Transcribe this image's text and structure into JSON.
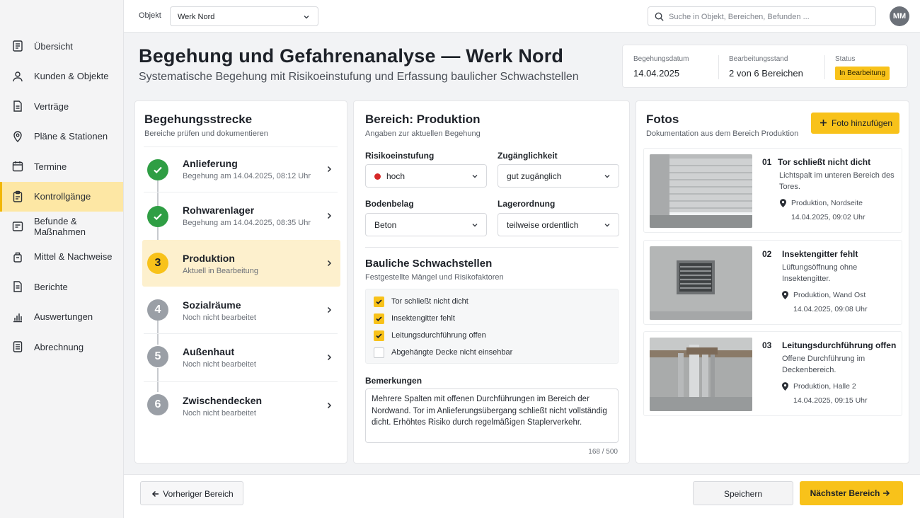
{
  "sidebar": {
    "items": [
      {
        "label": "Übersicht",
        "icon": "document-icon"
      },
      {
        "label": "Kunden & Objekte",
        "icon": "users-icon"
      },
      {
        "label": "Verträge",
        "icon": "contract-icon"
      },
      {
        "label": "Pläne & Stationen",
        "icon": "map-pin-icon"
      },
      {
        "label": "Termine",
        "icon": "calendar-icon"
      },
      {
        "label": "Kontrollgänge",
        "icon": "clipboard-icon",
        "active": true
      },
      {
        "label": "Befunde & Maßnahmen",
        "icon": "findings-icon"
      },
      {
        "label": "Mittel & Nachweise",
        "icon": "container-icon"
      },
      {
        "label": "Berichte",
        "icon": "report-icon"
      },
      {
        "label": "Auswertungen",
        "icon": "bar-chart-icon"
      },
      {
        "label": "Abrechnung",
        "icon": "invoice-icon"
      }
    ]
  },
  "topbar": {
    "object_label": "Objekt",
    "object_value": "Werk Nord",
    "search_placeholder": "Suche in Objekt, Bereichen, Befunden ...",
    "avatar": "MM"
  },
  "header": {
    "title": "Begehung und Gefahrenanalyse — Werk Nord",
    "subtitle": "Systematische Begehung mit Risikoeinstufung und Erfassung baulicher Schwachstellen",
    "meta": {
      "date_label": "Begehungsdatum",
      "date_value": "14.04.2025",
      "progress_label": "Bearbeitungsstand",
      "progress_value": "2 von 6 Bereichen",
      "status_label": "Status",
      "status_value": "In Bearbeitung"
    }
  },
  "route": {
    "title": "Begehungsstrecke",
    "subtitle": "Bereiche prüfen und dokumentieren",
    "items": [
      {
        "state": "done",
        "num": "",
        "name": "Anlieferung",
        "sub": "Begehung am 14.04.2025, 08:12 Uhr"
      },
      {
        "state": "done",
        "num": "",
        "name": "Rohwarenlager",
        "sub": "Begehung am 14.04.2025, 08:35 Uhr"
      },
      {
        "state": "current",
        "num": "3",
        "name": "Produktion",
        "sub": "Aktuell in Bearbeitung"
      },
      {
        "state": "todo",
        "num": "4",
        "name": "Sozialräume",
        "sub": "Noch nicht bearbeitet"
      },
      {
        "state": "todo",
        "num": "5",
        "name": "Außenhaut",
        "sub": "Noch nicht bearbeitet"
      },
      {
        "state": "todo",
        "num": "6",
        "name": "Zwischendecken",
        "sub": "Noch nicht bearbeitet"
      }
    ]
  },
  "area": {
    "title": "Bereich: Produktion",
    "subtitle": "Angaben zur aktuellen Begehung",
    "risk_label": "Risikoeinstufung",
    "risk_value": "hoch",
    "risk_color": "#d62828",
    "access_label": "Zugänglichkeit",
    "access_value": "gut zugänglich",
    "floor_label": "Bodenbelag",
    "floor_value": "Beton",
    "storage_label": "Lagerordnung",
    "storage_value": "teilweise ordentlich",
    "weak_title": "Bauliche Schwachstellen",
    "weak_subtitle": "Festgestellte Mängel und Risikofaktoren",
    "checks": [
      {
        "label": "Tor schließt nicht dicht",
        "checked": true
      },
      {
        "label": "Insektengitter fehlt",
        "checked": true
      },
      {
        "label": "Leitungsdurchführung offen",
        "checked": true
      },
      {
        "label": "Abgehängte Decke nicht einsehbar",
        "checked": false
      }
    ],
    "remarks_label": "Bemerkungen",
    "remarks_text": "Mehrere Spalten mit offenen Durchführungen im Bereich der Nordwand. Tor im Anlieferungsübergang schließt nicht vollständig dicht. Erhöhtes Risiko durch regelmäßigen Staplerverkehr.",
    "counter": "168 / 500"
  },
  "photos": {
    "title": "Fotos",
    "subtitle": "Dokumentation aus dem Bereich Produktion",
    "add_label": "Foto hinzufügen",
    "items": [
      {
        "num": "01",
        "title": "Tor schließt nicht dicht",
        "desc": "Lichtspalt im unteren Bereich des Tores.",
        "location": "Produktion, Nordseite",
        "time": "14.04.2025, 09:02 Uhr"
      },
      {
        "num": "02",
        "title": "Insektengitter fehlt",
        "desc": "Lüftungsöffnung ohne Insektengitter.",
        "location": "Produktion, Wand Ost",
        "time": "14.04.2025, 09:08 Uhr"
      },
      {
        "num": "03",
        "title": "Leitungsdurchführung offen",
        "desc": "Offene Durchführung im Deckenbereich.",
        "location": "Produktion, Halle 2",
        "time": "14.04.2025, 09:15 Uhr"
      }
    ]
  },
  "footer": {
    "prev_label": "Vorheriger Bereich",
    "save_label": "Speichern",
    "next_label": "Nächster Bereich"
  },
  "colors": {
    "accent": "#f8c21a",
    "done": "#2f9e44",
    "todo": "#9a9fa6"
  }
}
